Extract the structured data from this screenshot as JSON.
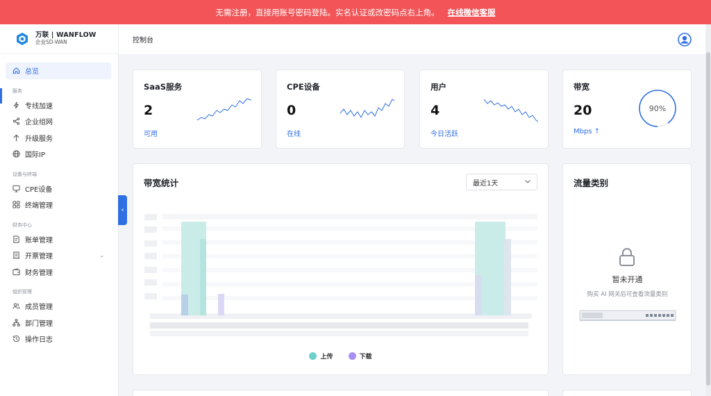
{
  "banner": {
    "message": "无需注册，直接用账号密码登陆。实名认证或改密码点右上角。",
    "link_label": "在线微信客服"
  },
  "brand": {
    "name": "万联 | WANFLOW",
    "subtitle": "企业SD-WAN"
  },
  "sidebar": {
    "items": [
      {
        "label": "总览",
        "icon": "home-icon"
      },
      {
        "label": "服务",
        "type": "section"
      },
      {
        "label": "专线加速",
        "icon": "bolt-icon"
      },
      {
        "label": "企业组网",
        "icon": "share-icon"
      },
      {
        "label": "升级服务",
        "icon": "arrow-up-icon"
      },
      {
        "label": "国际IP",
        "icon": "globe-icon"
      },
      {
        "label": "设备与终端",
        "type": "section"
      },
      {
        "label": "CPE设备",
        "icon": "monitor-icon"
      },
      {
        "label": "终端管理",
        "icon": "grid-icon"
      },
      {
        "label": "财务中心",
        "type": "section"
      },
      {
        "label": "账单管理",
        "icon": "bill-icon"
      },
      {
        "label": "开票管理",
        "icon": "invoice-icon"
      },
      {
        "label": "财务管理",
        "icon": "wallet-icon"
      },
      {
        "label": "组织管理",
        "type": "section"
      },
      {
        "label": "成员管理",
        "icon": "users-icon"
      },
      {
        "label": "部门管理",
        "icon": "org-icon"
      },
      {
        "label": "操作日志",
        "icon": "history-icon"
      }
    ]
  },
  "header": {
    "title": "控制台"
  },
  "stats": {
    "saas": {
      "title": "SaaS服务",
      "value": "2",
      "sub": "可用"
    },
    "cpe": {
      "title": "CPE设备",
      "value": "0",
      "sub": "在线"
    },
    "users": {
      "title": "用户",
      "value": "4",
      "sub": "今日活跃"
    },
    "bandwidth": {
      "title": "带宽",
      "value": "20",
      "sub": "Mbps ↑",
      "gauge_label": "90%",
      "gauge_fraction": 0.9
    }
  },
  "bandwidth_chart": {
    "title": "带宽统计",
    "range_select": "最近1天",
    "legend": [
      {
        "name": "上传",
        "color": "#6fd0cb"
      },
      {
        "name": "下载",
        "color": "#a98ef5"
      }
    ]
  },
  "traffic": {
    "title": "流量类别",
    "empty_title": "暂未开通",
    "empty_sub": "购买 AI 网关后可查看流量类别"
  },
  "colors": {
    "accent": "#2f6fe4",
    "banner": "#f25457",
    "upload": "#6fd0cb",
    "download": "#a98ef5"
  }
}
